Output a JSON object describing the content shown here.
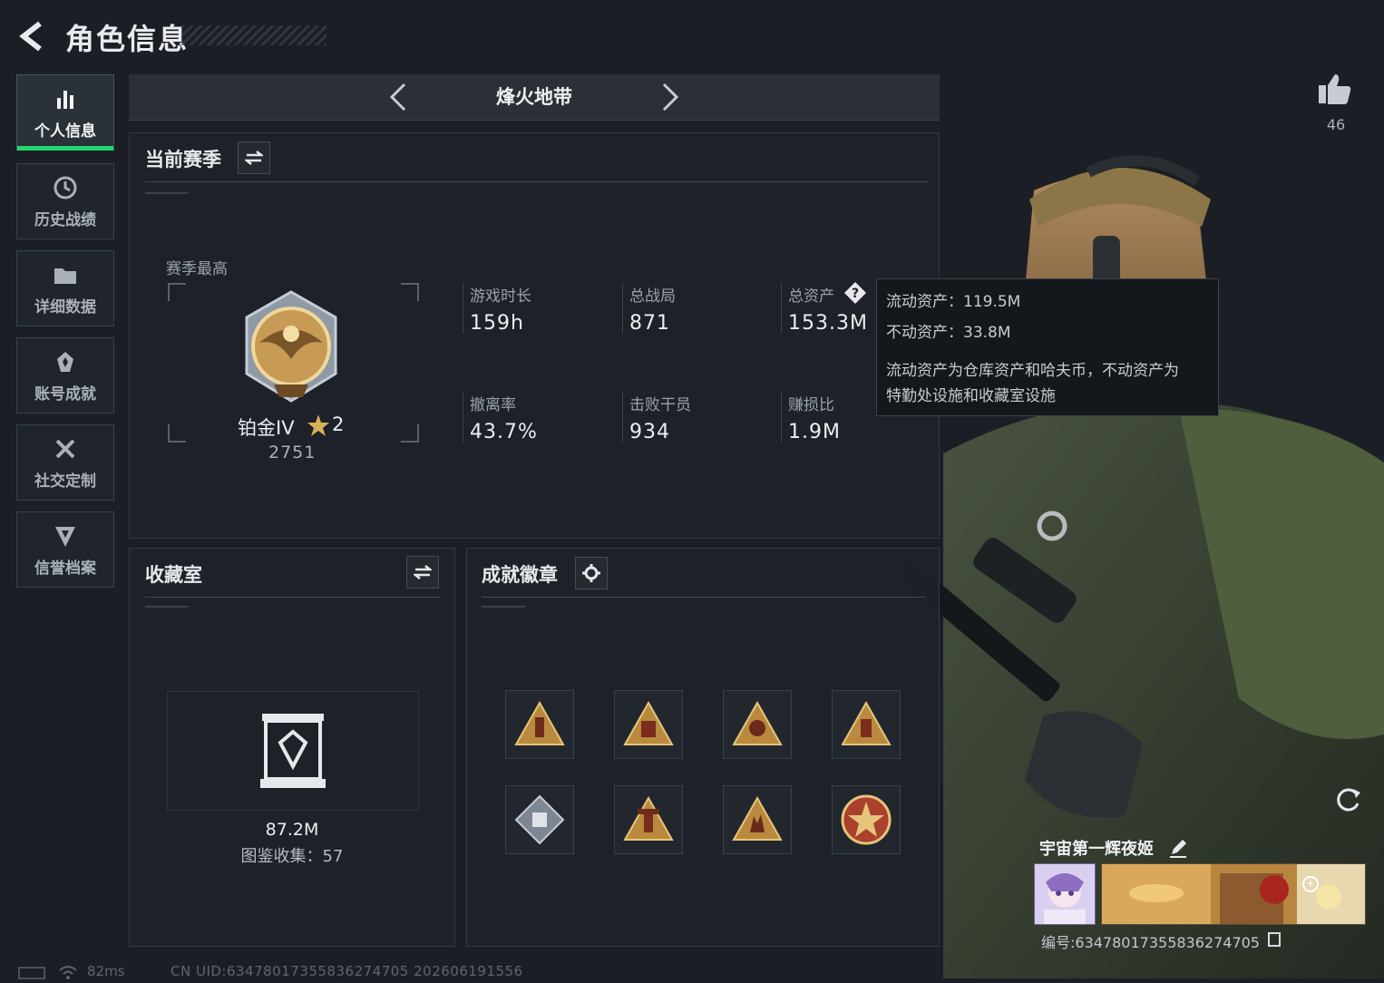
{
  "header": {
    "title": "角色信息"
  },
  "sidebar": {
    "items": [
      {
        "label": "个人信息",
        "icon": "bar-chart-icon",
        "active": true
      },
      {
        "label": "历史战绩",
        "icon": "history-clock-icon",
        "active": false
      },
      {
        "label": "详细数据",
        "icon": "folder-icon",
        "active": false
      },
      {
        "label": "账号成就",
        "icon": "achievement-star-icon",
        "active": false
      },
      {
        "label": "社交定制",
        "icon": "tools-icon",
        "active": false
      },
      {
        "label": "信誉档案",
        "icon": "shield-emblem-icon",
        "active": false
      }
    ]
  },
  "mode_bar": {
    "title": "烽火地带"
  },
  "season": {
    "title": "当前赛季",
    "best_label": "赛季最高",
    "rank": "铂金IV",
    "rank_stars": "2",
    "rank_points": "2751",
    "stats": [
      {
        "label": "游戏时长",
        "value": "159h"
      },
      {
        "label": "总战局",
        "value": "871"
      },
      {
        "label": "总资产",
        "value": "153.3M"
      },
      {
        "label": "撤离率",
        "value": "43.7%"
      },
      {
        "label": "击败干员",
        "value": "934"
      },
      {
        "label": "赚损比",
        "value": "1.9M"
      }
    ]
  },
  "tooltip": {
    "liquid": "流动资产：119.5M",
    "fixed": "不动资产：33.8M",
    "desc_line1": "流动资产为仓库资产和哈夫币，不动资产为",
    "desc_line2": "特勤处设施和收藏室设施"
  },
  "collection": {
    "title": "收藏室",
    "value": "87.2M",
    "catalog": "图鉴收集：57"
  },
  "badges": {
    "title": "成就徽章",
    "items": [
      {
        "icon": "triangle-badge-icon"
      },
      {
        "icon": "triangle-badge-icon"
      },
      {
        "icon": "triangle-badge-icon"
      },
      {
        "icon": "triangle-badge-icon"
      },
      {
        "icon": "diamond-badge-icon"
      },
      {
        "icon": "triangle-badge-icon"
      },
      {
        "icon": "triangle-badge-icon"
      },
      {
        "icon": "star-medal-badge-icon"
      }
    ]
  },
  "profile": {
    "likes": "46",
    "name": "宇宙第一辉夜姬",
    "id": "编号:634780173558362747​05"
  },
  "footer": {
    "ping": "82ms",
    "uid": "CN UID:6347801735583627470​5 202606191556"
  },
  "colors": {
    "accent_green": "#22d66e",
    "gold": "#c9a24e",
    "background": "#1b1f25"
  }
}
